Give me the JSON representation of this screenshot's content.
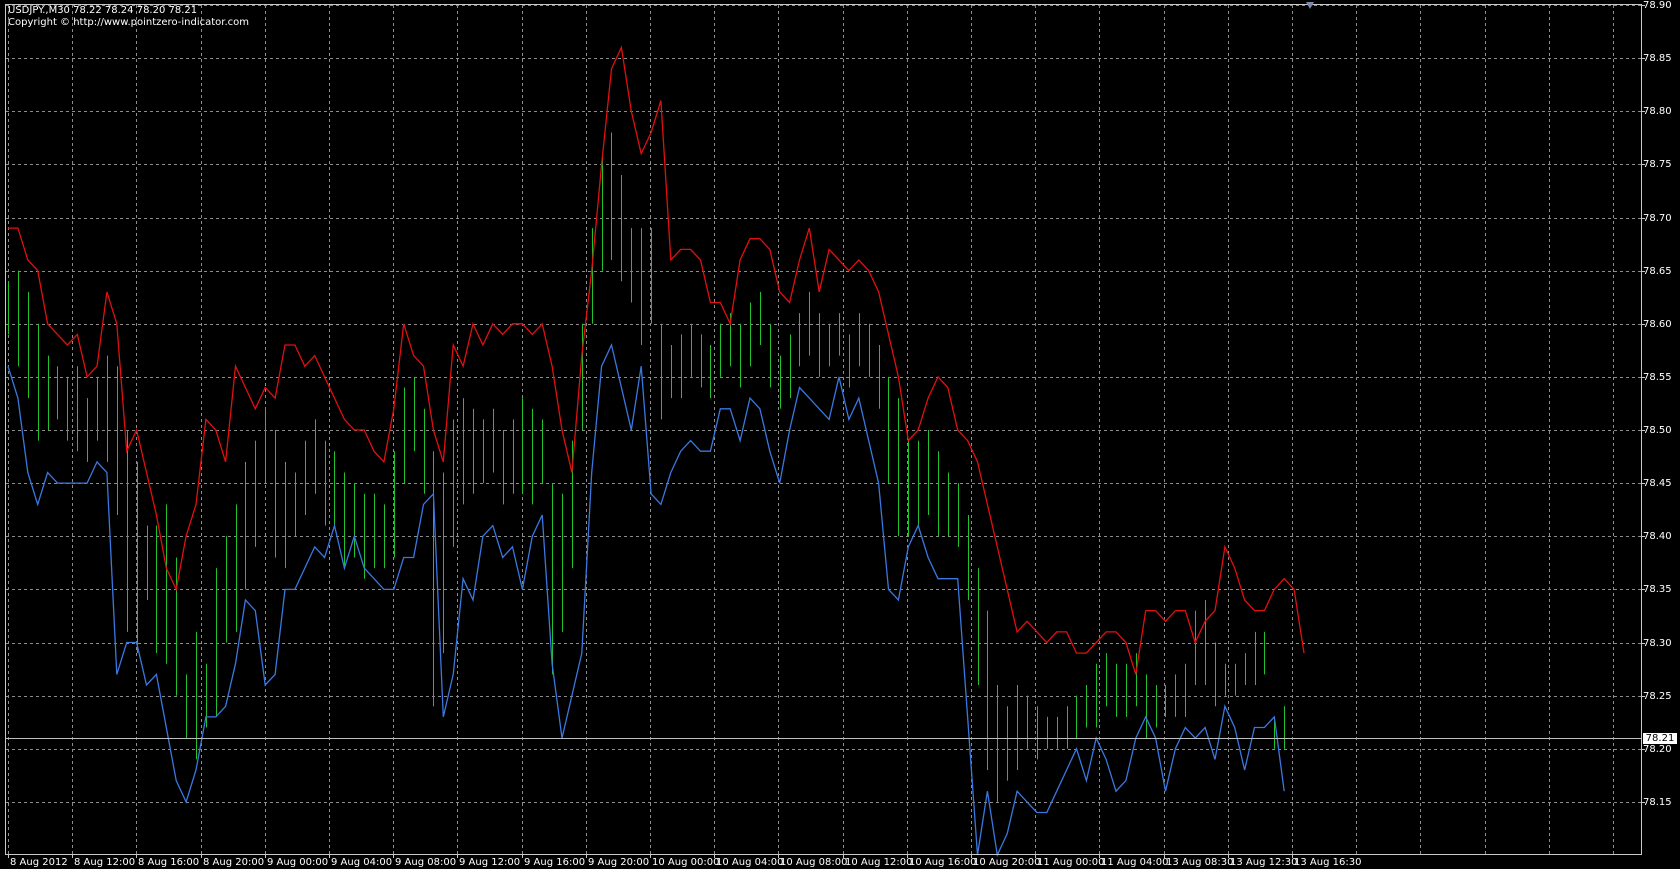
{
  "header": {
    "symbol_line": "USDJPY.,M30  78.22 78.24 78.20 78.21",
    "copyright_line": "Copyright © http://www.pointzero-indicator.com"
  },
  "current_price": "78.21",
  "colors": {
    "background": "#000000",
    "grid": "#8c8c8c",
    "upper_band": "#e01010",
    "lower_band": "#3a78e0",
    "bars": "#22c22a",
    "text": "#ffffff"
  },
  "chart_data": {
    "type": "line",
    "symbol": "USDJPY.",
    "timeframe": "M30",
    "ylim": [
      78.1,
      78.9
    ],
    "y_ticks": [
      "78.90",
      "78.85",
      "78.80",
      "78.75",
      "78.70",
      "78.65",
      "78.60",
      "78.55",
      "78.50",
      "78.45",
      "78.40",
      "78.35",
      "78.30",
      "78.25",
      "78.20",
      "78.15"
    ],
    "x_ticks": [
      "8 Aug 2012",
      "8 Aug 12:00",
      "8 Aug 16:00",
      "8 Aug 20:00",
      "9 Aug 00:00",
      "9 Aug 04:00",
      "9 Aug 08:00",
      "9 Aug 12:00",
      "9 Aug 16:00",
      "9 Aug 20:00",
      "10 Aug 00:00",
      "10 Aug 04:00",
      "10 Aug 08:00",
      "10 Aug 12:00",
      "10 Aug 16:00",
      "10 Aug 20:00",
      "11 Aug 00:00",
      "11 Aug 04:00",
      "13 Aug 08:30",
      "13 Aug 12:30",
      "13 Aug 16:30"
    ],
    "upper_band": [
      78.69,
      78.69,
      78.66,
      78.65,
      78.6,
      78.59,
      78.58,
      78.59,
      78.55,
      78.56,
      78.63,
      78.6,
      78.48,
      78.5,
      78.46,
      78.42,
      78.37,
      78.35,
      78.4,
      78.43,
      78.51,
      78.5,
      78.47,
      78.56,
      78.54,
      78.52,
      78.54,
      78.53,
      78.58,
      78.58,
      78.56,
      78.57,
      78.55,
      78.53,
      78.51,
      78.5,
      78.5,
      78.48,
      78.47,
      78.52,
      78.6,
      78.57,
      78.56,
      78.5,
      78.47,
      78.58,
      78.56,
      78.6,
      78.58,
      78.6,
      78.59,
      78.6,
      78.6,
      78.59,
      78.6,
      78.56,
      78.5,
      78.46,
      78.57,
      78.65,
      78.75,
      78.84,
      78.86,
      78.8,
      78.76,
      78.78,
      78.81,
      78.66,
      78.67,
      78.67,
      78.66,
      78.62,
      78.62,
      78.6,
      78.66,
      78.68,
      78.68,
      78.67,
      78.63,
      78.62,
      78.66,
      78.69,
      78.63,
      78.67,
      78.66,
      78.65,
      78.66,
      78.65,
      78.63,
      78.59,
      78.55,
      78.49,
      78.5,
      78.53,
      78.55,
      78.54,
      78.5,
      78.49,
      78.47,
      78.43,
      78.39,
      78.35,
      78.31,
      78.32,
      78.31,
      78.3,
      78.31,
      78.31,
      78.29,
      78.29,
      78.3,
      78.31,
      78.31,
      78.3,
      78.27,
      78.33,
      78.33,
      78.32,
      78.33,
      78.33,
      78.3,
      78.32,
      78.33,
      78.39,
      78.37,
      78.34,
      78.33,
      78.33,
      78.35,
      78.36,
      78.35,
      78.29
    ],
    "lower_band": [
      78.56,
      78.53,
      78.46,
      78.43,
      78.46,
      78.45,
      78.45,
      78.45,
      78.45,
      78.47,
      78.46,
      78.27,
      78.3,
      78.3,
      78.26,
      78.27,
      78.22,
      78.17,
      78.15,
      78.18,
      78.23,
      78.23,
      78.24,
      78.28,
      78.34,
      78.33,
      78.26,
      78.27,
      78.35,
      78.35,
      78.37,
      78.39,
      78.38,
      78.41,
      78.37,
      78.4,
      78.37,
      78.36,
      78.35,
      78.35,
      78.38,
      78.38,
      78.43,
      78.44,
      78.23,
      78.27,
      78.36,
      78.34,
      78.4,
      78.41,
      78.38,
      78.39,
      78.35,
      78.4,
      78.42,
      78.28,
      78.21,
      78.25,
      78.29,
      78.46,
      78.56,
      78.58,
      78.54,
      78.5,
      78.56,
      78.44,
      78.43,
      78.46,
      78.48,
      78.49,
      78.48,
      78.48,
      78.52,
      78.52,
      78.49,
      78.53,
      78.52,
      78.48,
      78.45,
      78.5,
      78.54,
      78.53,
      78.52,
      78.51,
      78.55,
      78.51,
      78.53,
      78.49,
      78.45,
      78.35,
      78.34,
      78.39,
      78.41,
      78.38,
      78.36,
      78.36,
      78.36,
      78.23,
      78.1,
      78.16,
      78.1,
      78.12,
      78.16,
      78.15,
      78.14,
      78.14,
      78.16,
      78.18,
      78.2,
      78.17,
      78.21,
      78.19,
      78.16,
      78.17,
      78.21,
      78.23,
      78.21,
      78.16,
      78.2,
      78.22,
      78.21,
      78.22,
      78.19,
      78.24,
      78.22,
      78.18,
      78.22,
      78.22,
      78.23,
      78.16
    ],
    "bars": [
      [
        78.64,
        78.59
      ],
      [
        78.65,
        78.56
      ],
      [
        78.63,
        78.53
      ],
      [
        78.6,
        78.49
      ],
      [
        78.57,
        78.5
      ],
      [
        78.56,
        78.51
      ],
      [
        78.55,
        78.49
      ],
      [
        78.56,
        78.48
      ],
      [
        78.53,
        78.47
      ],
      [
        78.55,
        78.49
      ],
      [
        78.57,
        78.47
      ],
      [
        78.56,
        78.42
      ],
      [
        78.5,
        78.31
      ],
      [
        78.47,
        78.29
      ],
      [
        78.41,
        78.34
      ],
      [
        78.41,
        78.29
      ],
      [
        78.43,
        78.28
      ],
      [
        78.38,
        78.25
      ],
      [
        78.27,
        78.21
      ],
      [
        78.31,
        78.19
      ],
      [
        78.28,
        78.22
      ],
      [
        78.37,
        78.23
      ],
      [
        78.4,
        78.3
      ],
      [
        78.43,
        78.31
      ],
      [
        78.47,
        78.35
      ],
      [
        78.49,
        78.39
      ],
      [
        78.52,
        78.45
      ],
      [
        78.5,
        78.38
      ],
      [
        78.47,
        78.37
      ],
      [
        78.46,
        78.4
      ],
      [
        78.49,
        78.42
      ],
      [
        78.51,
        78.44
      ],
      [
        78.49,
        78.41
      ],
      [
        78.48,
        78.41
      ],
      [
        78.46,
        78.37
      ],
      [
        78.45,
        78.38
      ],
      [
        78.44,
        78.36
      ],
      [
        78.44,
        78.37
      ],
      [
        78.43,
        78.37
      ],
      [
        78.48,
        78.38
      ],
      [
        78.54,
        78.45
      ],
      [
        78.55,
        78.48
      ],
      [
        78.52,
        78.44
      ],
      [
        78.48,
        78.24
      ],
      [
        78.46,
        78.29
      ],
      [
        78.51,
        78.39
      ],
      [
        78.53,
        78.43
      ],
      [
        78.52,
        78.44
      ],
      [
        78.51,
        78.45
      ],
      [
        78.52,
        78.46
      ],
      [
        78.5,
        78.43
      ],
      [
        78.51,
        78.44
      ],
      [
        78.53,
        78.44
      ],
      [
        78.52,
        78.43
      ],
      [
        78.51,
        78.45
      ],
      [
        78.45,
        78.27
      ],
      [
        78.44,
        78.31
      ],
      [
        78.49,
        78.37
      ],
      [
        78.6,
        78.5
      ],
      [
        78.69,
        78.6
      ],
      [
        78.76,
        78.65
      ],
      [
        78.78,
        78.66
      ],
      [
        78.74,
        78.64
      ],
      [
        78.69,
        78.62
      ],
      [
        78.69,
        78.58
      ],
      [
        78.69,
        78.6
      ],
      [
        78.6,
        78.51
      ],
      [
        78.58,
        78.53
      ],
      [
        78.59,
        78.53
      ],
      [
        78.6,
        78.55
      ],
      [
        78.59,
        78.54
      ],
      [
        78.58,
        78.53
      ],
      [
        78.6,
        78.55
      ],
      [
        78.61,
        78.56
      ],
      [
        78.6,
        78.54
      ],
      [
        78.62,
        78.56
      ],
      [
        78.63,
        78.58
      ],
      [
        78.6,
        78.54
      ],
      [
        78.57,
        78.52
      ],
      [
        78.59,
        78.53
      ],
      [
        78.61,
        78.56
      ],
      [
        78.63,
        78.57
      ],
      [
        78.61,
        78.55
      ],
      [
        78.6,
        78.56
      ],
      [
        78.61,
        78.57
      ],
      [
        78.59,
        78.54
      ],
      [
        78.61,
        78.56
      ],
      [
        78.6,
        78.55
      ],
      [
        78.58,
        78.52
      ],
      [
        78.55,
        78.45
      ],
      [
        78.53,
        78.4
      ],
      [
        78.49,
        78.4
      ],
      [
        78.49,
        78.41
      ],
      [
        78.5,
        78.42
      ],
      [
        78.48,
        78.4
      ],
      [
        78.46,
        78.4
      ],
      [
        78.45,
        78.39
      ],
      [
        78.42,
        78.34
      ],
      [
        78.37,
        78.26
      ],
      [
        78.33,
        78.18
      ],
      [
        78.26,
        78.15
      ],
      [
        78.24,
        78.17
      ],
      [
        78.26,
        78.18
      ],
      [
        78.25,
        78.2
      ],
      [
        78.24,
        78.19
      ],
      [
        78.23,
        78.2
      ],
      [
        78.23,
        78.2
      ],
      [
        78.24,
        78.2
      ],
      [
        78.25,
        78.21
      ],
      [
        78.26,
        78.22
      ],
      [
        78.28,
        78.22
      ],
      [
        78.29,
        78.24
      ],
      [
        78.28,
        78.23
      ],
      [
        78.28,
        78.23
      ],
      [
        78.29,
        78.24
      ],
      [
        78.27,
        78.21
      ],
      [
        78.26,
        78.22
      ],
      [
        78.26,
        78.23
      ],
      [
        78.27,
        78.23
      ],
      [
        78.28,
        78.23
      ],
      [
        78.33,
        78.26
      ],
      [
        78.34,
        78.26
      ],
      [
        78.3,
        78.24
      ],
      [
        78.28,
        78.25
      ],
      [
        78.28,
        78.25
      ],
      [
        78.29,
        78.26
      ],
      [
        78.31,
        78.26
      ],
      [
        78.31,
        78.27
      ],
      [
        78.23,
        78.2
      ],
      [
        78.24,
        78.2
      ]
    ]
  }
}
